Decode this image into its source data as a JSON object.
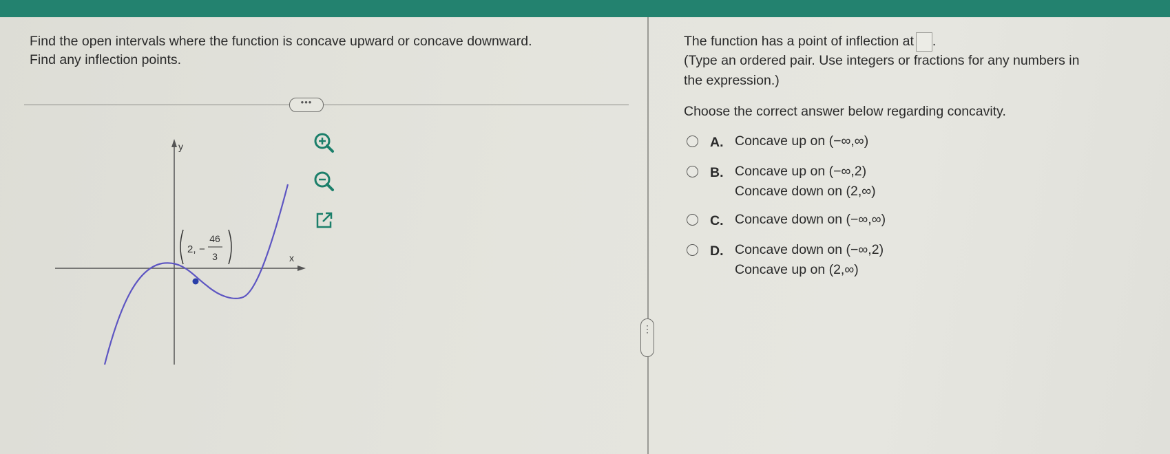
{
  "question": {
    "line1": "Find the open intervals where the function is concave upward or concave downward.",
    "line2": "Find any inflection points."
  },
  "expand_button": "•••",
  "graph": {
    "y_label": "y",
    "x_label": "x",
    "point_label_x": "2,",
    "point_label_sign": "−",
    "point_label_num": "46",
    "point_label_den": "3"
  },
  "tools": {
    "zoom_in": "zoom-in-icon",
    "zoom_out": "zoom-out-icon",
    "popout": "external-link-icon"
  },
  "answer_section": {
    "inflection_line": "The function has a point of inflection at",
    "inflection_end": ".",
    "instruction_1": "(Type an ordered pair. Use integers or fractions for any numbers in",
    "instruction_2": "the expression.)",
    "choose_prompt": "Choose the correct answer below regarding concavity."
  },
  "options": [
    {
      "letter": "A.",
      "line1": "Concave up on (−∞,∞)",
      "line2": ""
    },
    {
      "letter": "B.",
      "line1": "Concave up on (−∞,2)",
      "line2": "Concave down on (2,∞)"
    },
    {
      "letter": "C.",
      "line1": "Concave down on (−∞,∞)",
      "line2": ""
    },
    {
      "letter": "D.",
      "line1": "Concave down on (−∞,2)",
      "line2": "Concave up on (2,∞)"
    }
  ],
  "side_handle": "⋮"
}
